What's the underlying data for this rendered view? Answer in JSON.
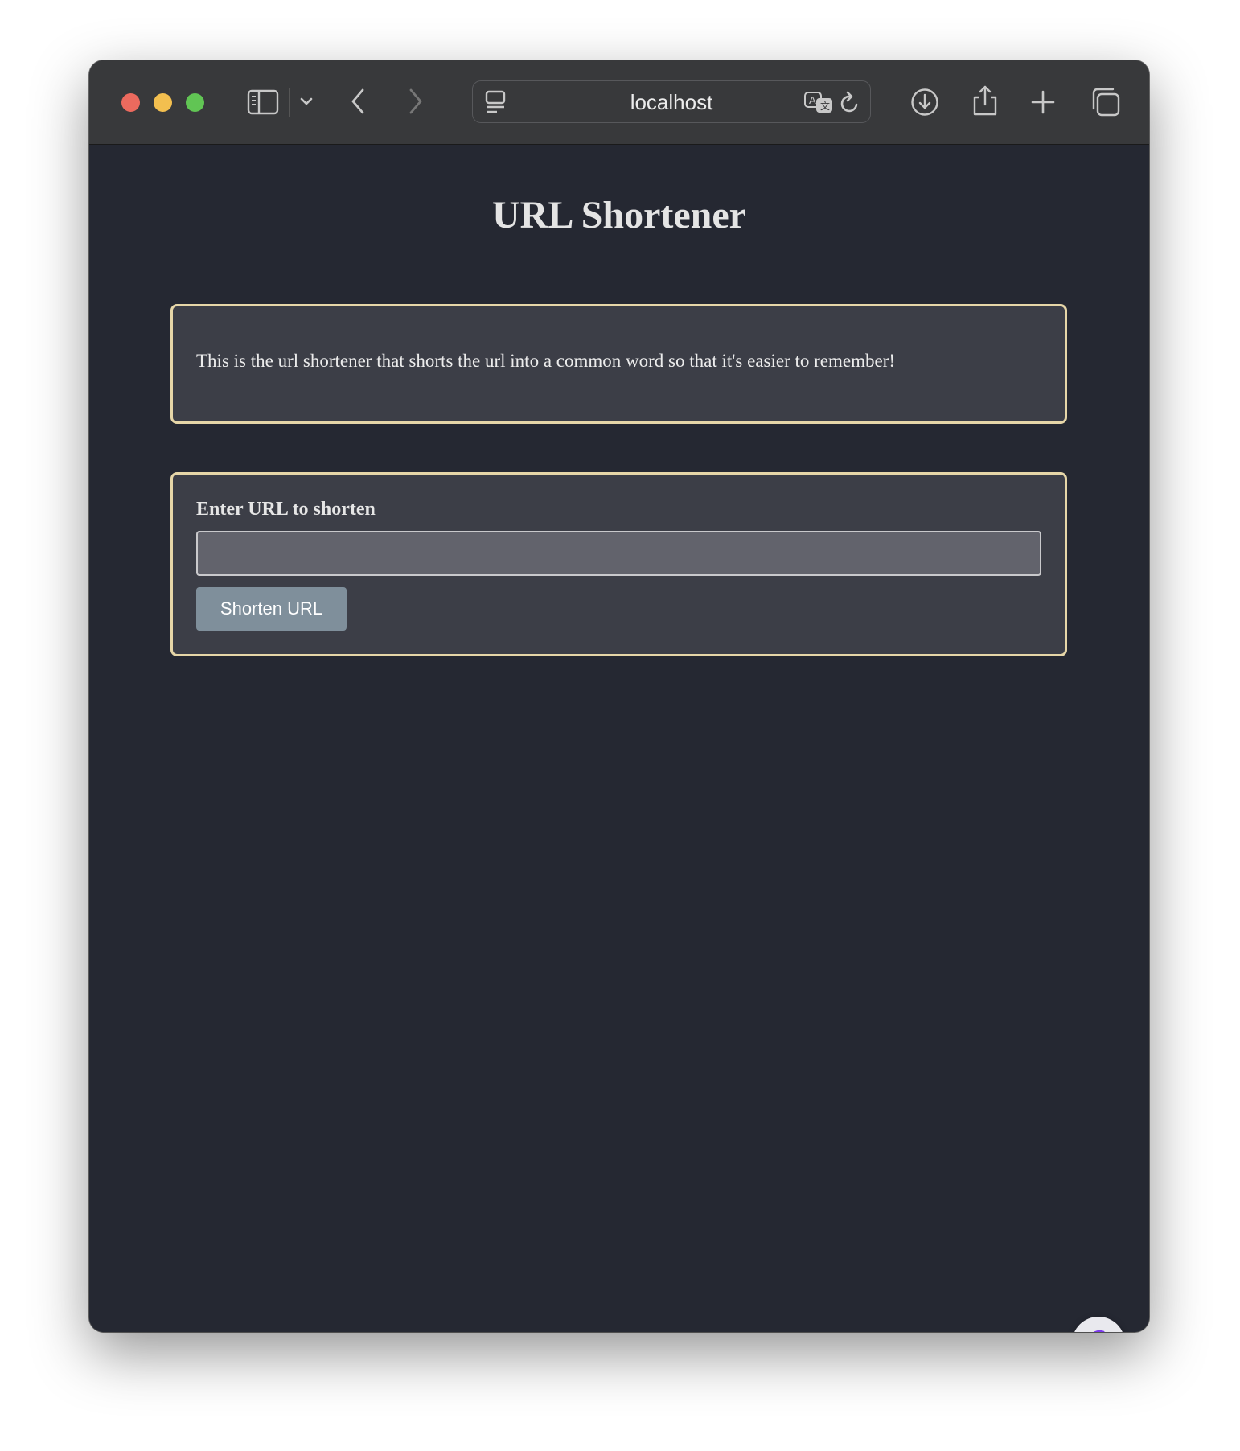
{
  "browser": {
    "address": "localhost",
    "icons": {
      "sidebar": "sidebar-icon",
      "tab_group": "chevron-down-icon",
      "back": "back-icon",
      "forward": "forward-icon",
      "page_menu": "page-menu-icon",
      "translate": "translate-icon",
      "reload": "reload-icon",
      "downloads": "download-icon",
      "share": "share-icon",
      "new_tab": "plus-icon",
      "tabs_overview": "tabs-icon"
    }
  },
  "page": {
    "title": "URL Shortener",
    "description": "This is the url shortener that shorts the url into a common word so that it's easier to remember!",
    "form": {
      "label": "Enter URL to shorten",
      "input_value": "",
      "input_placeholder": "",
      "button_label": "Shorten URL"
    },
    "theme_toggle_icon": "moon-icon"
  },
  "colors": {
    "background": "#252832",
    "card": "#3c3e47",
    "card_border": "#e6d6a8",
    "button": "#7f8f9b",
    "moon_icon": "#7c3aed"
  }
}
